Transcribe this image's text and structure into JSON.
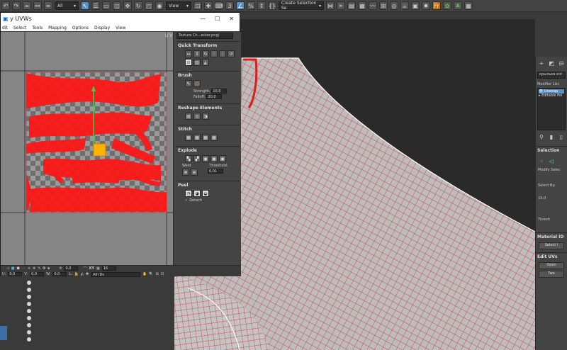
{
  "main_toolbar": {
    "selection_filter": "All",
    "reference_coord": "View",
    "selection_set": "Create Selection Se"
  },
  "uvw_editor": {
    "title": "y UVWs",
    "menu": [
      "dit",
      "Select",
      "Tools",
      "Mapping",
      "Options",
      "Display",
      "View"
    ],
    "uv_label": "U V",
    "texture_dropdown": "Texture Ch...ecker.png)",
    "panels": {
      "quick_transform": "Quick Transform",
      "brush": "Brush",
      "strength_label": "Strength:",
      "strength_value": "10,0",
      "falloff_label": "Falloff:",
      "falloff_value": "20,0",
      "reshape": "Reshape Elements",
      "stitch": "Stitch",
      "explode": "Explode",
      "weld_label": "Weld",
      "threshold_label": "Threshold:",
      "threshold_value": "0,01",
      "peel": "Peel",
      "detach_label": "Detach"
    },
    "bottom": {
      "u_label": "U:",
      "u_value": "0,0",
      "v_label": "V:",
      "v_value": "0,0",
      "w_label": "W:",
      "w_value": "0,0",
      "l_label": "L:",
      "spin_value": "0,0",
      "xy_label": "XY",
      "grid_value": "16",
      "ids_dropdown": "All IDs"
    }
  },
  "command_panel": {
    "object_name": "крыльев.std",
    "modifier_list_label": "Modifier List",
    "stack_items": [
      "Unwrap",
      "Editable Pol"
    ],
    "selection_title": "Selection",
    "modify_label": "Modify Selec",
    "select_by_label": "Select By:",
    "angle_value": "15,0",
    "threshold_label": "Thresh",
    "material_ids_title": "Material ID",
    "select_id_button": "Select I",
    "edit_uvs_title": "Edit UVs",
    "open_button": "Open",
    "tweak_button": "Twe"
  },
  "colors": {
    "uv_red": "#ff1414",
    "wire_red": "#d62020",
    "accent_blue": "#5a8fc4"
  }
}
